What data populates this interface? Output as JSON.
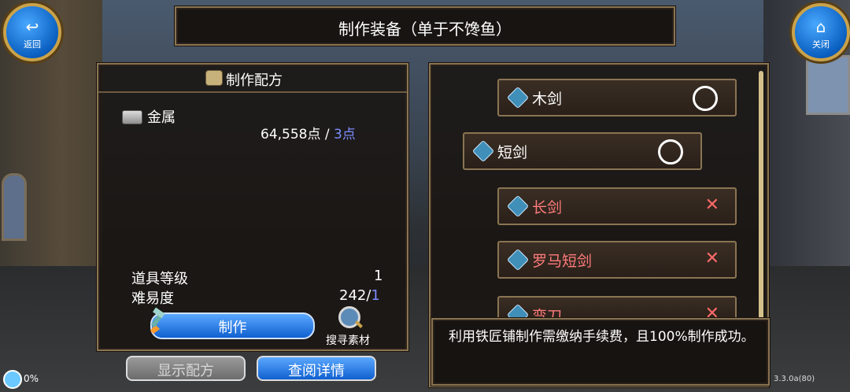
{
  "header": {
    "title": "制作装备（单于不馋鱼）",
    "back_label": "返回",
    "close_label": "关闭"
  },
  "recipe": {
    "title": "制作配方",
    "material_name": "金属",
    "material_amount": "64,558点",
    "separator": "/",
    "material_cost": "3点",
    "item_level_label": "道具等级",
    "item_level_value": "1",
    "difficulty_label": "难易度",
    "difficulty_value": "242/",
    "difficulty_max": "1",
    "make_label": "制作",
    "search_label": "搜寻素材",
    "show_recipe_label": "显示配方",
    "details_label": "查阅详情"
  },
  "items": [
    {
      "name": "木剑",
      "status": "circle"
    },
    {
      "name": "短剑",
      "status": "circle"
    },
    {
      "name": "长剑",
      "status": "cross"
    },
    {
      "name": "罗马短剑",
      "status": "cross"
    },
    {
      "name": "弯刀",
      "status": "cross"
    }
  ],
  "description": "利用铁匠铺制作需缴纳手续费，且100%制作成功。",
  "footer": {
    "percent": "0%",
    "version": "3.3.0a(80)"
  },
  "status_marks": {
    "ok": "○",
    "no": "✕"
  }
}
